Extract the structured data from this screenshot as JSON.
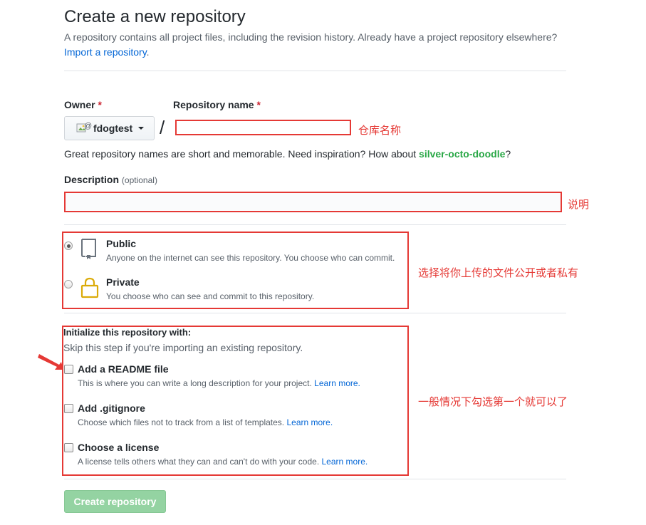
{
  "header": {
    "title": "Create a new repository",
    "subtitle": "A repository contains all project files, including the revision history. Already have a project repository elsewhere?",
    "import_link": "Import a repository",
    "import_tail": "."
  },
  "owner": {
    "label": "Owner",
    "required_mark": "*",
    "name": "fdogtest",
    "avatar_alt": "@"
  },
  "repo_name": {
    "label": "Repository name",
    "required_mark": "*",
    "value": "",
    "annotation": "仓库名称"
  },
  "name_hint": {
    "text": "Great repository names are short and memorable. Need inspiration? How about ",
    "suggestion": "silver-octo-doodle",
    "tail": "?"
  },
  "description": {
    "label": "Description",
    "optional": "(optional)",
    "value": "",
    "annotation": "说明"
  },
  "visibility": {
    "annotation": "选择将你上传的文件公开或者私有",
    "selected": "public",
    "options": [
      {
        "title": "Public",
        "note": "Anyone on the internet can see this repository. You choose who can commit."
      },
      {
        "title": "Private",
        "note": "You choose who can see and commit to this repository."
      }
    ]
  },
  "init": {
    "title": "Initialize this repository with:",
    "subtitle": "Skip this step if you're importing an existing repository.",
    "annotation": "一般情况下勾选第一个就可以了",
    "learn_more": "Learn more.",
    "items": [
      {
        "title": "Add a README file",
        "note": "This is where you can write a long description for your project.",
        "checked": false
      },
      {
        "title": "Add .gitignore",
        "note": "Choose which files not to track from a list of templates.",
        "checked": false
      },
      {
        "title": "Choose a license",
        "note": "A license tells others what they can and can't do with your code.",
        "checked": false
      }
    ]
  },
  "submit": {
    "label": "Create repository"
  },
  "colors": {
    "annotation_red": "#e53935",
    "link_blue": "#0366d6",
    "suggest_green": "#28a745",
    "button_green_disabled": "#94d3a2",
    "private_lock": "#dbab09"
  },
  "icons": [
    "repo-book-icon",
    "lock-icon",
    "caret-down-icon",
    "red-arrow-icon"
  ]
}
